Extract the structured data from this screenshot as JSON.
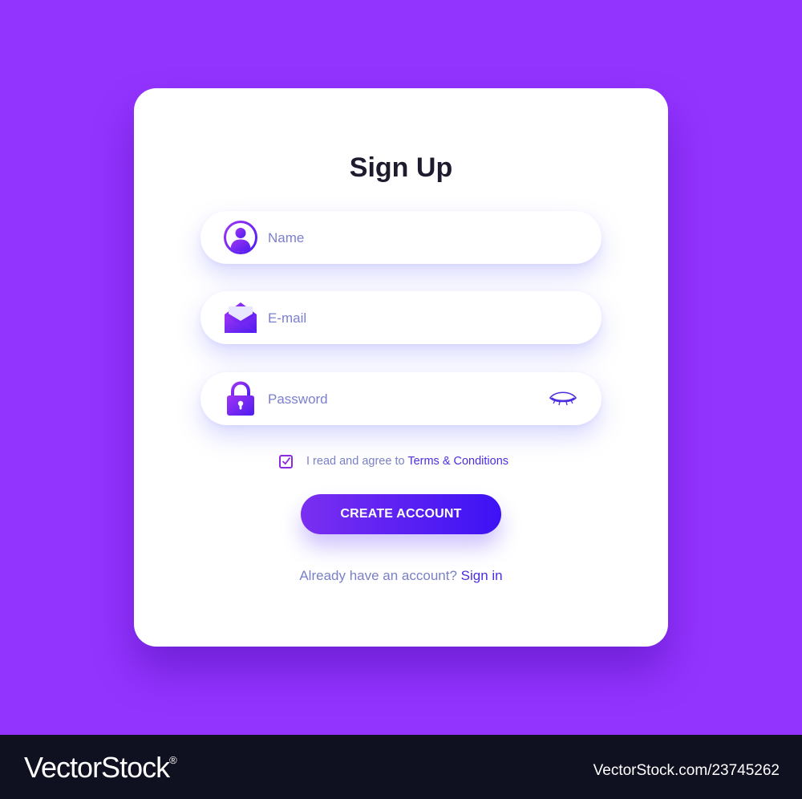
{
  "colors": {
    "background": "#9333fe",
    "card": "#ffffff",
    "accent": "#4b2ee0",
    "button_gradient_start": "#7a2ff0",
    "button_gradient_end": "#3d12f5",
    "footer": "#101120"
  },
  "form": {
    "title": "Sign Up",
    "fields": [
      {
        "icon": "user-icon",
        "value": "",
        "placeholder": "Name",
        "type": "text"
      },
      {
        "icon": "envelope-icon",
        "value": "",
        "placeholder": "E-mail",
        "type": "email"
      },
      {
        "icon": "lock-icon",
        "value": "",
        "placeholder": "Password",
        "type": "password",
        "trailing_icon": "eye-closed-icon"
      }
    ],
    "agree": {
      "checked": true,
      "text": "I read and agree to ",
      "link": "Terms & Conditions"
    },
    "submit_label": "CREATE ACCOUNT",
    "signin_prompt": "Already have an account? ",
    "signin_link": "Sign in"
  },
  "footer": {
    "brand": "VectorStock",
    "brand_mark": "®",
    "stock_id": "VectorStock.com/23745262"
  }
}
